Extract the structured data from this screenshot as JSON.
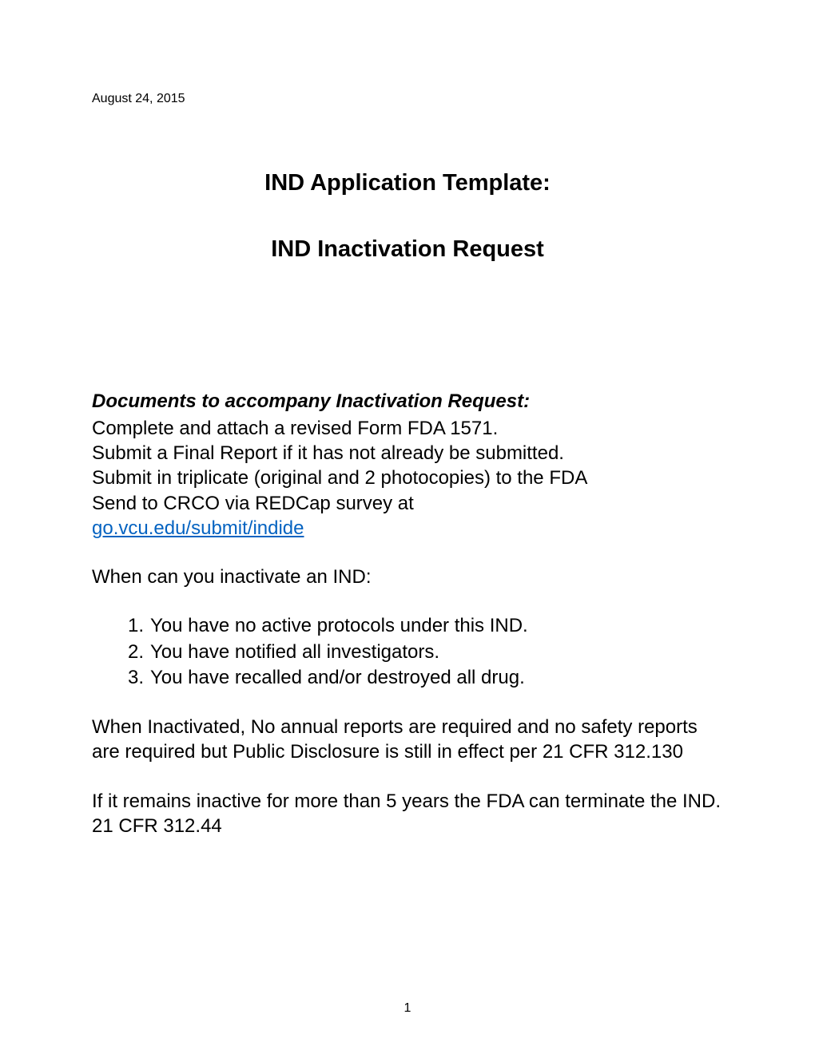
{
  "date": "August 24, 2015",
  "title": "IND Application Template:",
  "subtitle": "IND Inactivation Request",
  "section_heading": "Documents to accompany Inactivation Request:",
  "instructions": {
    "line1": "Complete and attach a revised Form FDA 1571.",
    "line2": "Submit a Final Report if it has not already be submitted.",
    "line3": "Submit in triplicate (original and 2 photocopies) to the FDA",
    "line4": "Send to CRCO via REDCap survey at",
    "link": "go.vcu.edu/submit/indide"
  },
  "question": "When can you inactivate an IND:",
  "list": {
    "item1": "You have no active protocols under this IND.",
    "item2": "You have notified all investigators.",
    "item3": "You have recalled and/or destroyed all drug."
  },
  "paragraph1": "When Inactivated, No annual reports are required and no safety reports are required but Public Disclosure is still in effect per 21 CFR 312.130",
  "paragraph2": "If it remains inactive for more than 5 years the FDA can terminate the IND.  21 CFR 312.44",
  "page_number": "1"
}
